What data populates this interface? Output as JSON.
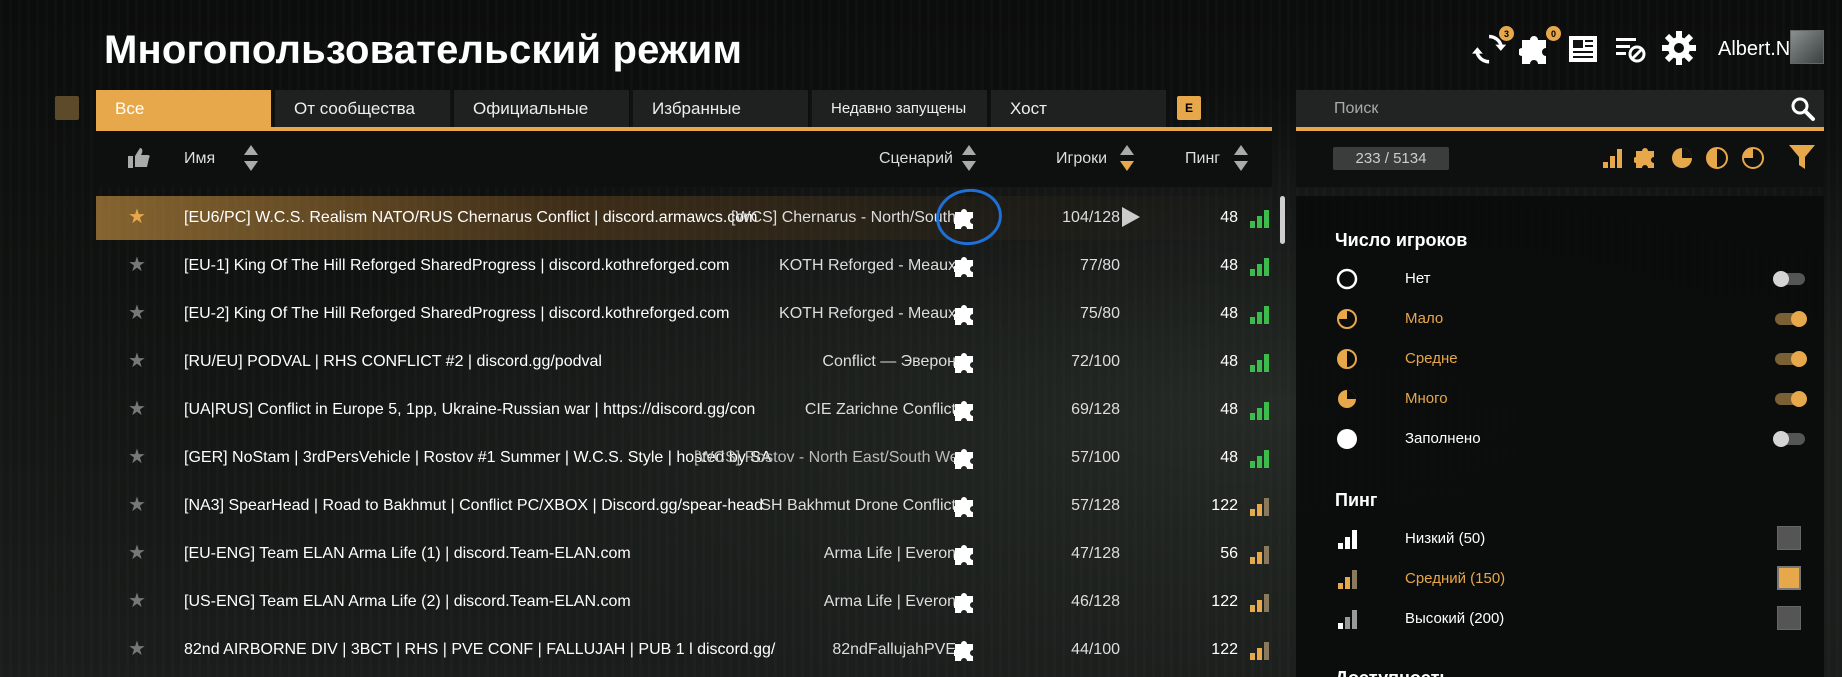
{
  "header": {
    "title": "Многопользовательский режим",
    "username": "Albert.N",
    "icons": [
      {
        "name": "refresh-icon",
        "badge": "3"
      },
      {
        "name": "puzzle-icon",
        "badge": "0"
      },
      {
        "name": "news-icon",
        "badge": ""
      },
      {
        "name": "blocked-list-icon",
        "badge": ""
      },
      {
        "name": "gear-icon",
        "badge": ""
      }
    ]
  },
  "tabs": [
    {
      "label": "Все",
      "active": true
    },
    {
      "label": "От сообщества",
      "active": false
    },
    {
      "label": "Официальные",
      "active": false
    },
    {
      "label": "Избранные",
      "active": false
    },
    {
      "label": "Недавно запущены",
      "active": false
    },
    {
      "label": "Хост",
      "active": false
    }
  ],
  "tab_badge": "E",
  "columns": {
    "name": "Имя",
    "scenario": "Сценарий",
    "players": "Игроки",
    "ping": "Пинг"
  },
  "servers": [
    {
      "fav": true,
      "name": "[EU6/PC] W.C.S. Realism NATO/RUS Chernarus Conflict | discord.armawcs.com",
      "scenario": "[WCS] Chernarus - North/South",
      "players": "104/128",
      "ping": "48",
      "ping_level": "low",
      "selected": true
    },
    {
      "fav": false,
      "name": "[EU-1] King Of The Hill Reforged SharedProgress | discord.kothreforged.com",
      "scenario": "KOTH Reforged - Meaux",
      "players": "77/80",
      "ping": "48",
      "ping_level": "low"
    },
    {
      "fav": false,
      "name": "[EU-2] King Of The Hill Reforged SharedProgress | discord.kothreforged.com",
      "scenario": "KOTH Reforged - Meaux",
      "players": "75/80",
      "ping": "48",
      "ping_level": "low"
    },
    {
      "fav": false,
      "name": "[RU/EU] PODVAL | RHS CONFLICT #2 | discord.gg/podval",
      "scenario": "Conflict — Эверон",
      "players": "72/100",
      "ping": "48",
      "ping_level": "low"
    },
    {
      "fav": false,
      "name": "[UA|RUS] Conflict in Europe 5, 1pp, Ukraine-Russian war | https://discord.gg/con",
      "scenario": "CIE Zarichne Conflict",
      "players": "69/128",
      "ping": "48",
      "ping_level": "low"
    },
    {
      "fav": false,
      "name": "[GER] NoStam | 3rdPersVehicle | Rostov #1 Summer | W.C.S. Style | hosted by SA",
      "scenario": "[WCS] Rostov - North East/South West",
      "players": "57/100",
      "ping": "48",
      "ping_level": "low"
    },
    {
      "fav": false,
      "name": "[NA3] SpearHead | Road to Bakhmut | Conflict PC/XBOX | Discord.gg/spear-head",
      "scenario": "SH Bakhmut Drone Conflict",
      "players": "57/128",
      "ping": "122",
      "ping_level": "medium"
    },
    {
      "fav": false,
      "name": "[EU-ENG] Team ELAN Arma Life (1) | discord.Team-ELAN.com",
      "scenario": "Arma Life | Everon",
      "players": "47/128",
      "ping": "56",
      "ping_level": "medium"
    },
    {
      "fav": false,
      "name": "[US-ENG] Team ELAN Arma Life (2) | discord.Team-ELAN.com",
      "scenario": "Arma Life | Everon",
      "players": "46/128",
      "ping": "122",
      "ping_level": "medium"
    },
    {
      "fav": false,
      "name": "82nd AIRBORNE DIV | 3BCT | RHS | PVE CONF | FALLUJAH | PUB 1 l discord.gg/",
      "scenario": "82ndFallujahPVE",
      "players": "44/100",
      "ping": "122",
      "ping_level": "medium"
    }
  ],
  "search": {
    "placeholder": "Поиск"
  },
  "server_count": "233 / 5134",
  "filters": {
    "players_title": "Число игроков",
    "players_options": [
      {
        "label": "Нет",
        "on": false,
        "icon": "empty-circle-icon"
      },
      {
        "label": "Мало",
        "on": true,
        "icon": "quarter-circle-icon"
      },
      {
        "label": "Средне",
        "on": true,
        "icon": "half-circle-icon"
      },
      {
        "label": "Много",
        "on": true,
        "icon": "three-quarter-circle-icon"
      },
      {
        "label": "Заполнено",
        "on": false,
        "icon": "full-circle-icon"
      }
    ],
    "ping_title": "Пинг",
    "ping_options": [
      {
        "label": "Низкий (50)",
        "on": false,
        "icon": "signal-low-icon"
      },
      {
        "label": "Средний (150)",
        "on": true,
        "icon": "signal-medium-icon"
      },
      {
        "label": "Высокий (200)",
        "on": false,
        "icon": "signal-high-icon"
      }
    ],
    "next_section_title": "Доступность"
  },
  "colors": {
    "accent": "#e6a84a",
    "ping_good": "#3dbb4c",
    "annotation": "#1e6fd6"
  }
}
